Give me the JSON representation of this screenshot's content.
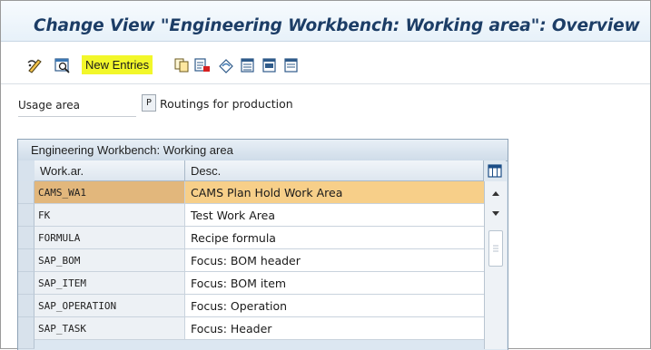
{
  "window": {
    "title": "Change View \"Engineering Workbench: Working area\": Overview"
  },
  "toolbar": {
    "new_entries_label": "New Entries",
    "icons": [
      "display-change-icon",
      "details-icon",
      "new-entries",
      "copy-icon",
      "delete-icon",
      "undo-icon",
      "select-all-icon",
      "select-block-icon",
      "deselect-all-icon"
    ]
  },
  "usage": {
    "label": "Usage area",
    "code": "P",
    "description": "Routings for production"
  },
  "table": {
    "title": "Engineering Workbench: Working area",
    "columns": [
      "Work.ar.",
      "Desc."
    ],
    "rows": [
      {
        "workar": "CAMS_WA1",
        "desc": "CAMS Plan Hold Work Area",
        "selected": true
      },
      {
        "workar": "FK",
        "desc": "Test Work Area",
        "selected": false
      },
      {
        "workar": "FORMULA",
        "desc": "Recipe formula",
        "selected": false
      },
      {
        "workar": "SAP_BOM",
        "desc": "Focus: BOM header",
        "selected": false
      },
      {
        "workar": "SAP_ITEM",
        "desc": "Focus: BOM item",
        "selected": false
      },
      {
        "workar": "SAP_OPERATION",
        "desc": "Focus: Operation",
        "selected": false
      },
      {
        "workar": "SAP_TASK",
        "desc": "Focus: Header",
        "selected": false
      }
    ]
  },
  "colors": {
    "title": "#1c3d66",
    "highlight": "#f2f72a",
    "selected_row": "#f7cf89"
  }
}
